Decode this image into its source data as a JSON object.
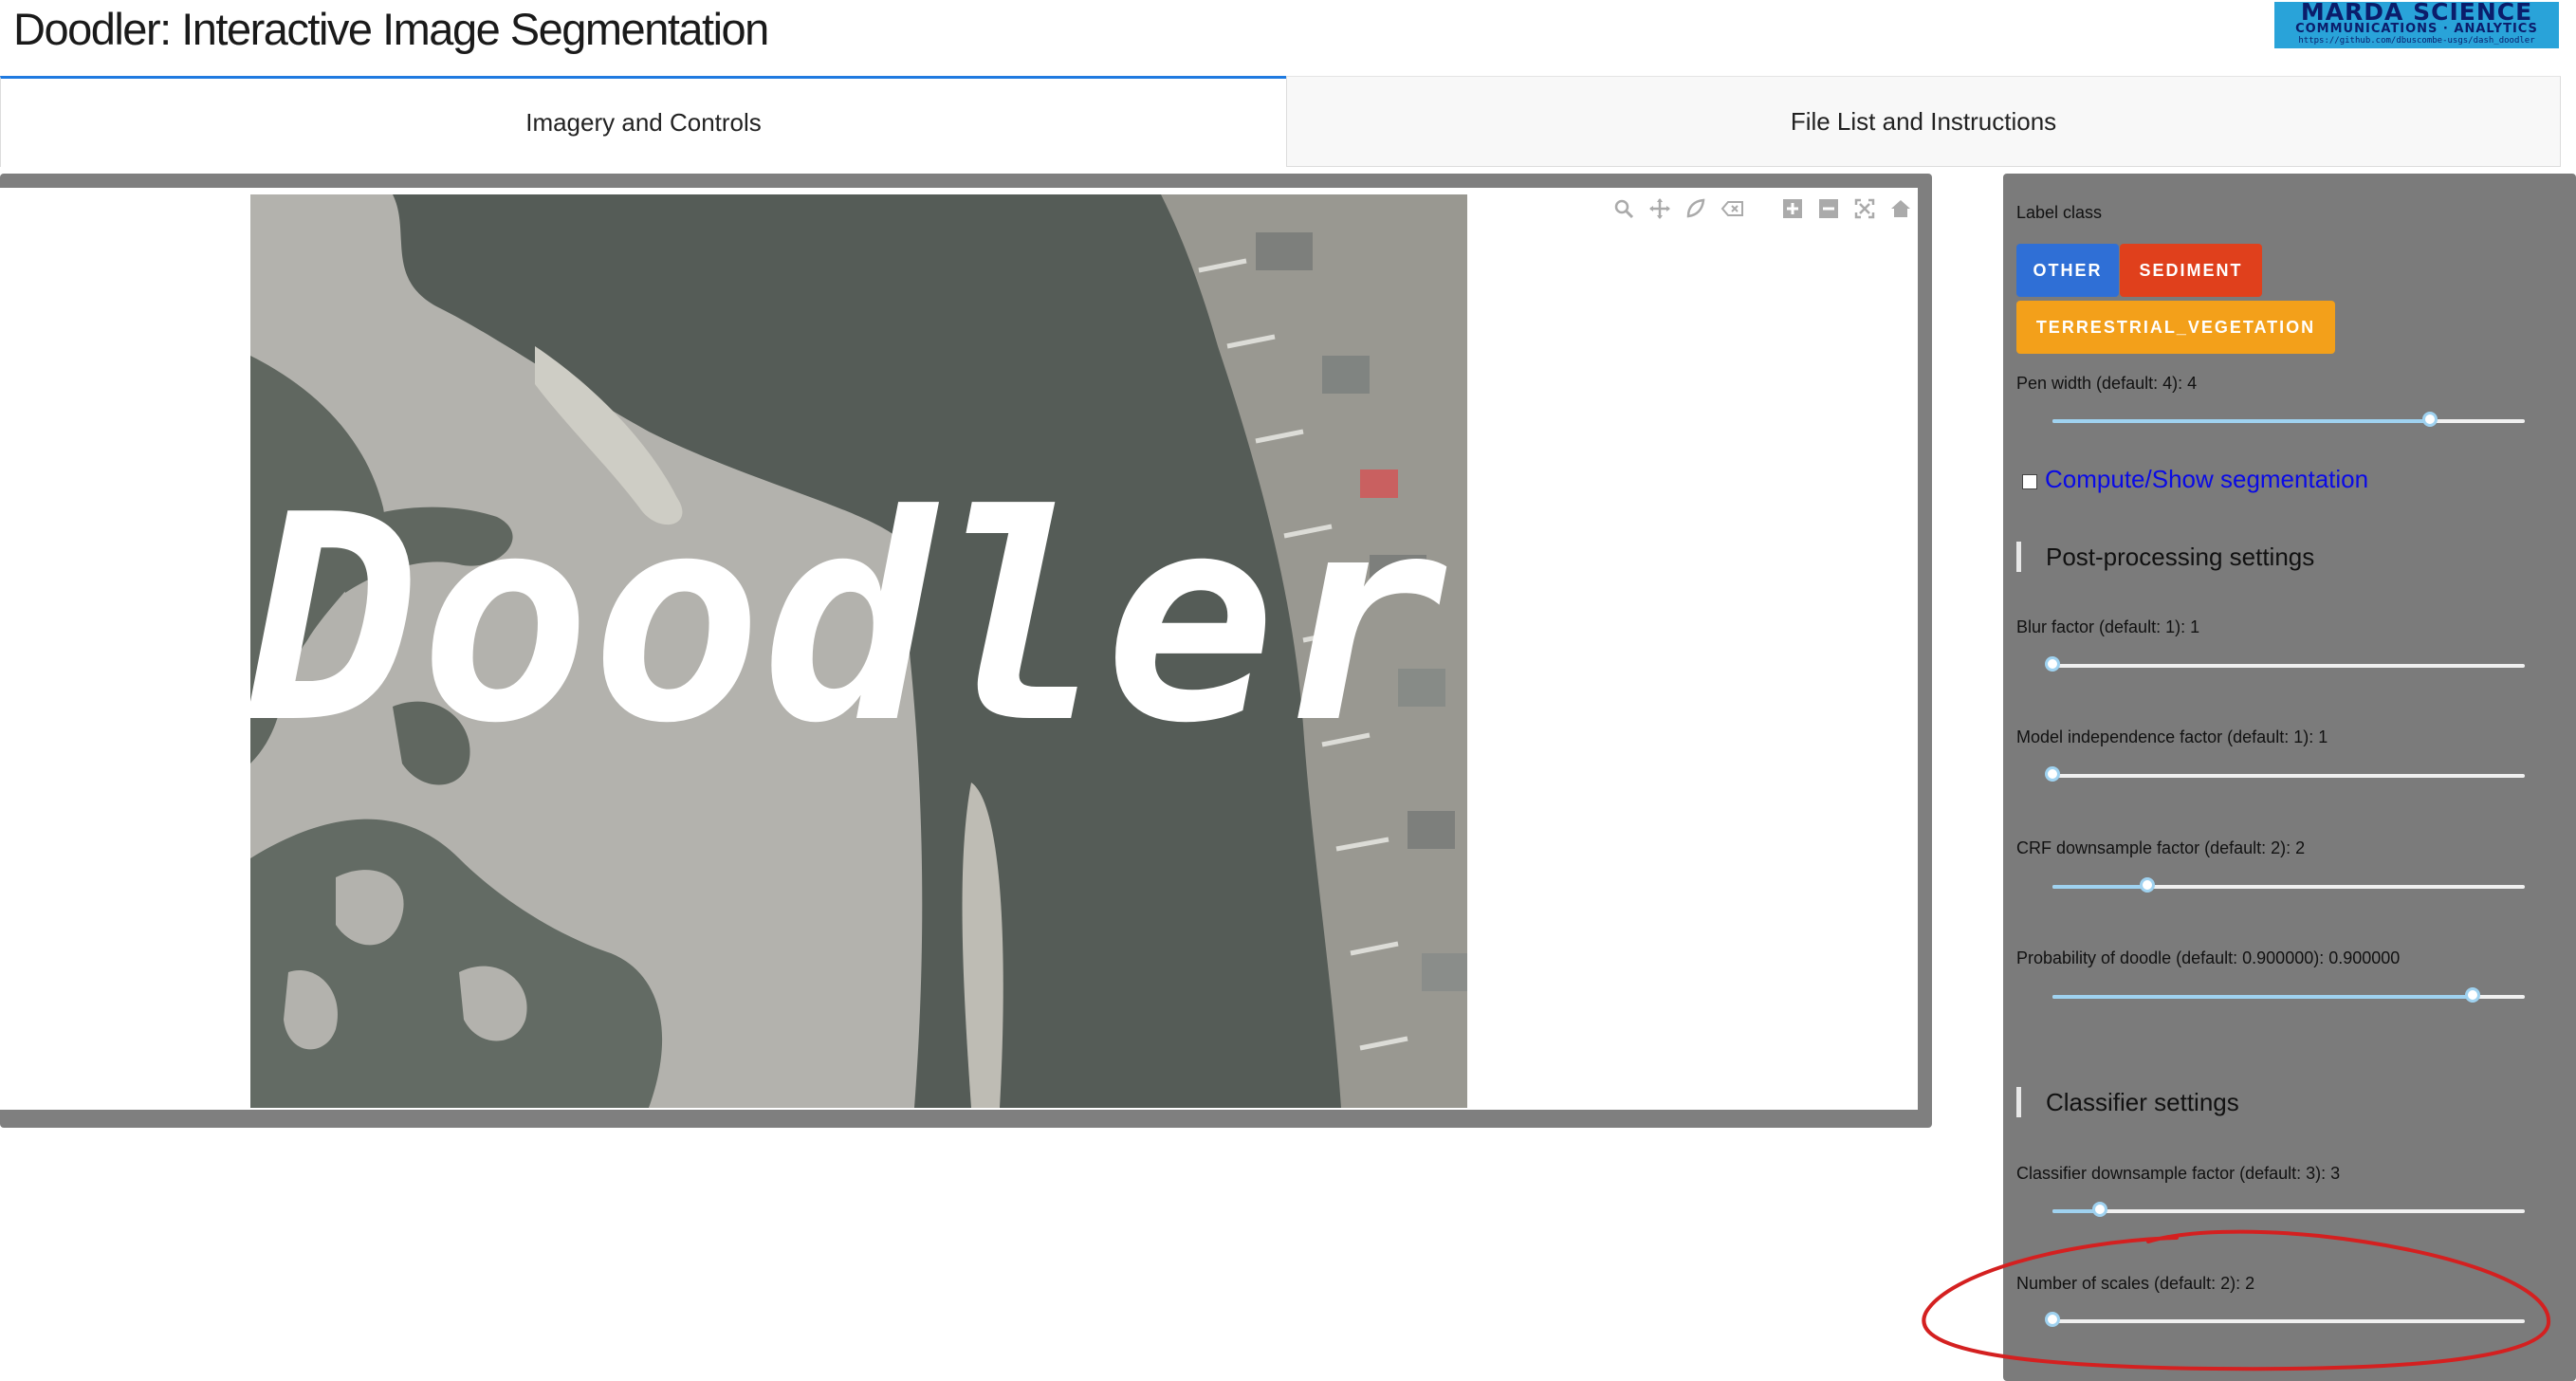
{
  "header": {
    "title": "Doodler: Interactive Image Segmentation",
    "logo": {
      "line1": "MARDA SCIENCE",
      "line2": "COMMUNICATIONS · ANALYTICS",
      "line3": "https://github.com/dbuscombe-usgs/dash_doodler"
    }
  },
  "tabs": [
    {
      "label": "Imagery and Controls",
      "active": true
    },
    {
      "label": "File List and Instructions",
      "active": false
    }
  ],
  "image": {
    "overlay_text": "Doodler"
  },
  "modebar": {
    "icons": [
      "zoom-icon",
      "pan-icon",
      "draw-icon",
      "erase-shape-icon",
      "zoom-in-icon",
      "zoom-out-icon",
      "autoscale-icon",
      "reset-axes-icon"
    ]
  },
  "controls": {
    "label_class_title": "Label class",
    "classes": [
      {
        "label": "OTHER",
        "color": "#2f6fd6"
      },
      {
        "label": "SEDIMENT",
        "color": "#e0401c"
      },
      {
        "label": "TERRESTRIAL_VEGETATION",
        "color": "#f3a01a"
      }
    ],
    "pen_width": {
      "label": "Pen width (default: 4): 4",
      "fraction": 0.8
    },
    "compute": {
      "label": "Compute/Show segmentation",
      "checked": false
    },
    "postprocessing": {
      "title": "Post-processing settings",
      "blur": {
        "label": "Blur factor (default: 1): 1",
        "fraction": 0.0
      },
      "model_independence": {
        "label": "Model independence factor (default: 1): 1",
        "fraction": 0.0
      },
      "crf_downsample": {
        "label": "CRF downsample factor (default: 2): 2",
        "fraction": 0.2
      },
      "prob_doodle": {
        "label": "Probability of doodle (default: 0.900000): 0.900000",
        "fraction": 0.89
      }
    },
    "classifier": {
      "title": "Classifier settings",
      "downsample": {
        "label": "Classifier downsample factor (default: 3): 3",
        "fraction": 0.1
      },
      "num_scales": {
        "label": "Number of scales (default: 2): 2",
        "fraction": 0.0
      }
    }
  },
  "annotation": {
    "color": "#d42020"
  }
}
